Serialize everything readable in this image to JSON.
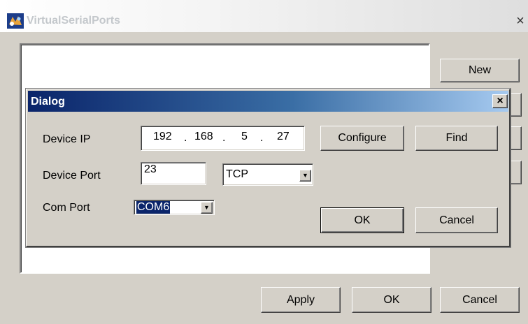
{
  "main_window": {
    "title": "VirtualSerialPorts",
    "close_label": "×",
    "buttons": {
      "new": "New",
      "apply": "Apply",
      "ok": "OK",
      "cancel": "Cancel"
    }
  },
  "dialog": {
    "title": "Dialog",
    "close_label": "×",
    "device_ip": {
      "label": "Device IP",
      "octets": [
        "192",
        "168",
        "5",
        "27"
      ],
      "separator": "."
    },
    "device_port": {
      "label": "Device Port",
      "value": "23"
    },
    "protocol": {
      "selected": "TCP"
    },
    "com_port": {
      "label": "Com Port",
      "selected": "COM6"
    },
    "buttons": {
      "configure": "Configure",
      "find": "Find",
      "ok": "OK",
      "cancel": "Cancel"
    }
  },
  "icons": {
    "app": "app-icon",
    "close": "close-icon",
    "dropdown": "chevron-down-icon"
  },
  "colors": {
    "dialog_titlebar_start": "#0a246a",
    "dialog_titlebar_end": "#a6caf0",
    "window_face": "#d4d0c8",
    "selection": "#0a246a"
  }
}
